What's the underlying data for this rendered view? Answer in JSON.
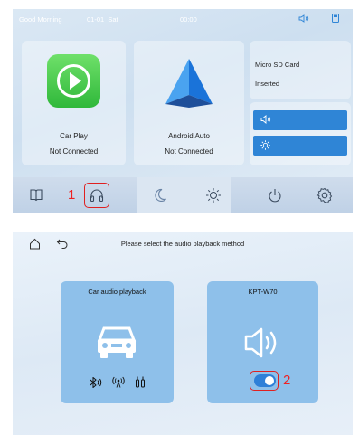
{
  "screen1": {
    "status": {
      "greeting": "Good Morning",
      "date": "01-01",
      "weekday": "Sat",
      "time": "00:00"
    },
    "carplay": {
      "name": "Car Play",
      "status": "Not Connected"
    },
    "android_auto": {
      "name": "Android Auto",
      "status": "Not Connected"
    },
    "sd_card": {
      "title": "Micro SD Card",
      "status": "Inserted"
    },
    "dock": {
      "items": [
        "book-icon",
        "headphones-icon",
        "moon-icon",
        "sun-icon",
        "power-icon",
        "gear-icon"
      ],
      "active": "moon-icon"
    },
    "annotation_1": "1"
  },
  "screen2": {
    "title": "Please select the audio playback method",
    "car_audio": {
      "label": "Car audio playback"
    },
    "kpt": {
      "label": "KPT-W70",
      "toggle_on": true
    },
    "annotation_2": "2"
  },
  "colors": {
    "accent": "#2f85d6",
    "annotation": "#e02020",
    "carplay_green": "#3ac045"
  }
}
